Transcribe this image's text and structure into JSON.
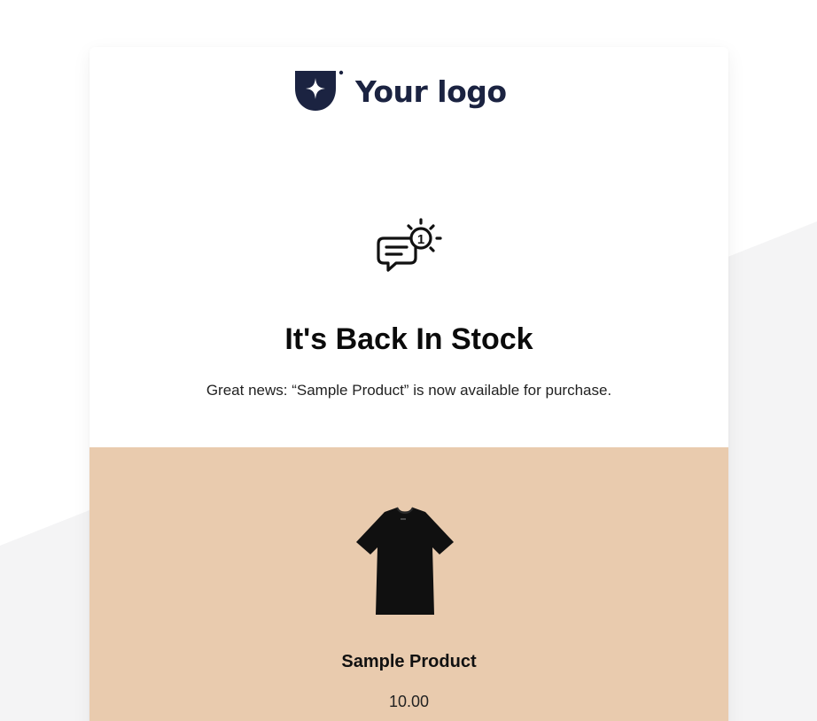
{
  "colors": {
    "page_background": "#ffffff",
    "background_shape": "#f4f4f5",
    "card_background": "#ffffff",
    "logo_color": "#1b2341",
    "product_section_background": "#e9cbae",
    "title_color": "#0b0b0b"
  },
  "header": {
    "logo_icon": "brand-shield-star-icon",
    "logo_text": "Your logo"
  },
  "hero": {
    "icon": "chat-notification-icon",
    "title": "It's Back In Stock",
    "message": "Great news: “Sample Product” is now available for purchase."
  },
  "product": {
    "image_icon": "black-tshirt-image",
    "name": "Sample Product",
    "price": "10.00"
  }
}
